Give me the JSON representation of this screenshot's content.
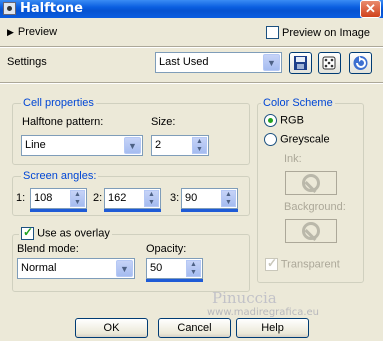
{
  "window": {
    "title": "Halftone",
    "close": "✕"
  },
  "preview": {
    "toggle_label": "Preview",
    "preview_on_image_label": "Preview on Image",
    "preview_on_image_checked": false
  },
  "settings": {
    "label": "Settings",
    "value": "Last Used"
  },
  "cell_properties": {
    "title": "Cell properties",
    "pattern_label": "Halftone pattern:",
    "pattern_value": "Line",
    "size_label": "Size:",
    "size_value": "2"
  },
  "screen_angles": {
    "title": "Screen angles:",
    "items": [
      {
        "label": "1:",
        "value": "108"
      },
      {
        "label": "2:",
        "value": "162"
      },
      {
        "label": "3:",
        "value": "90"
      }
    ]
  },
  "overlay": {
    "checkbox_label": "Use as overlay",
    "checked": true,
    "blend_label": "Blend mode:",
    "blend_value": "Normal",
    "opacity_label": "Opacity:",
    "opacity_value": "50"
  },
  "color_scheme": {
    "title": "Color Scheme",
    "rgb_label": "RGB",
    "greyscale_label": "Greyscale",
    "selected": "RGB",
    "ink_label": "Ink:",
    "background_label": "Background:",
    "transparent_label": "Transparent",
    "transparent_checked": true
  },
  "buttons": {
    "ok": "OK",
    "cancel": "Cancel",
    "help": "Help"
  },
  "watermark": {
    "line1": "Pinuccia",
    "line2": "www.madiregrafica.eu"
  },
  "colors": {
    "titlebar": "#0a5ee0",
    "group_title": "#0046d5",
    "dialog_bg": "#ece9d8"
  }
}
